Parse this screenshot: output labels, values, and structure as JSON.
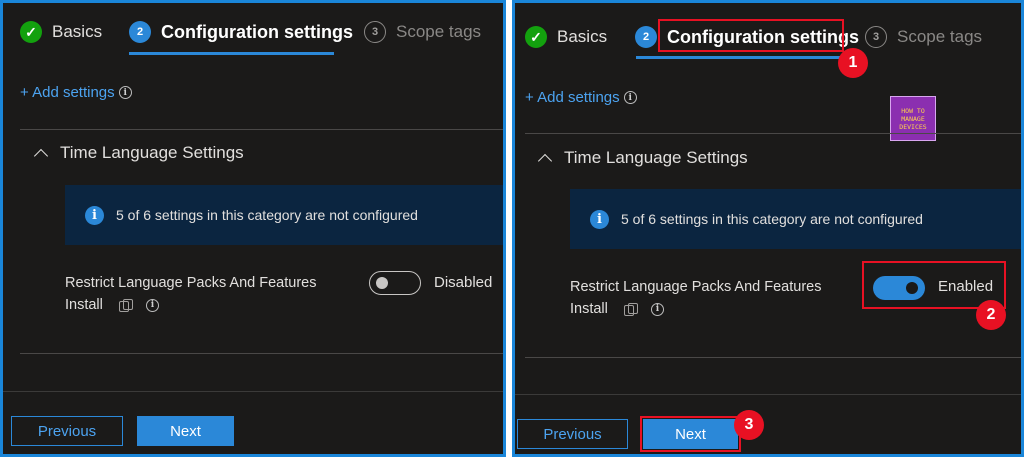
{
  "tabs": {
    "basics": "Basics",
    "config": "Configuration settings",
    "config_num": "2",
    "scope": "Scope tags",
    "scope_num": "3"
  },
  "add_settings": "+ Add settings",
  "section_title": "Time Language Settings",
  "banner_text": "5 of 6 settings in this category are not configured",
  "setting": {
    "label_line1": "Restrict Language Packs And Features",
    "label_line2": "Install"
  },
  "left_state": "Disabled",
  "right_state": "Enabled",
  "buttons": {
    "previous": "Previous",
    "next": "Next"
  },
  "markers": [
    "1",
    "2",
    "3"
  ],
  "logo": {
    "line1": "HOW TO",
    "line2": "MANAGE",
    "line3": "DEVICES"
  },
  "colors": {
    "accent": "#2b88d8",
    "highlight": "#e81123",
    "success": "#13a10e",
    "background": "#1b1a19"
  }
}
